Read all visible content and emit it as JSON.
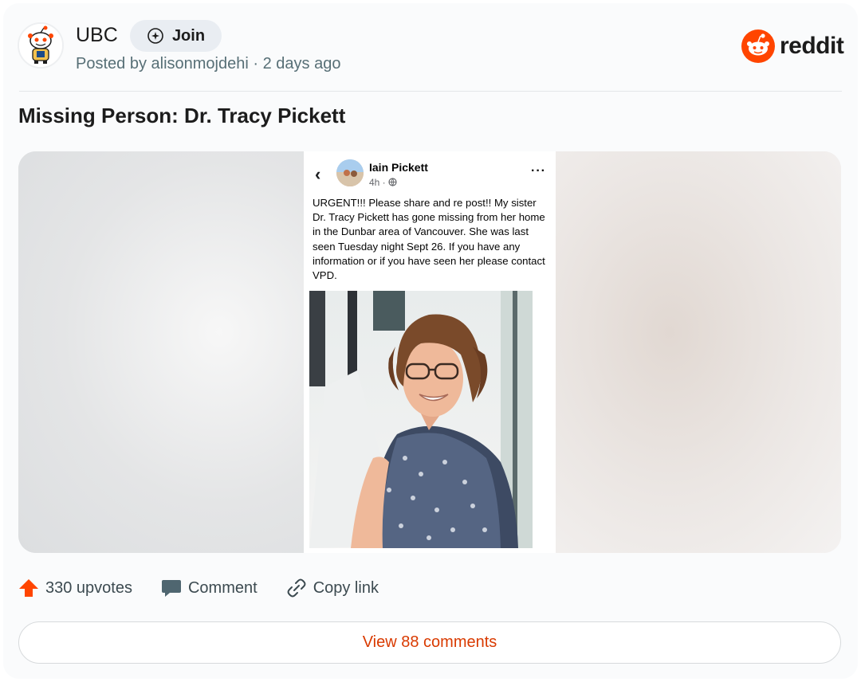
{
  "header": {
    "subreddit": "UBC",
    "join_label": "Join",
    "posted_prefix": "Posted by ",
    "author": "alisonmojdehi",
    "time_sep": " · ",
    "time": "2 days ago",
    "brand_word": "reddit"
  },
  "post": {
    "title": "Missing Person: Dr. Tracy Pickett"
  },
  "embedded_post": {
    "author": "Iain Pickett",
    "time": "4h · ",
    "body": "URGENT!!! Please share and re post!! My sister Dr. Tracy Pickett has gone missing from her home in the Dunbar area of Vancouver. She was last seen Tuesday night Sept 26. If you have any information or if you have seen her please contact VPD."
  },
  "actions": {
    "upvotes": "330 upvotes",
    "comment": "Comment",
    "copy_link": "Copy link"
  },
  "footer": {
    "view_comments": "View 88 comments"
  },
  "colors": {
    "brand_orange": "#ff4500",
    "link_orange": "#d93a00"
  }
}
